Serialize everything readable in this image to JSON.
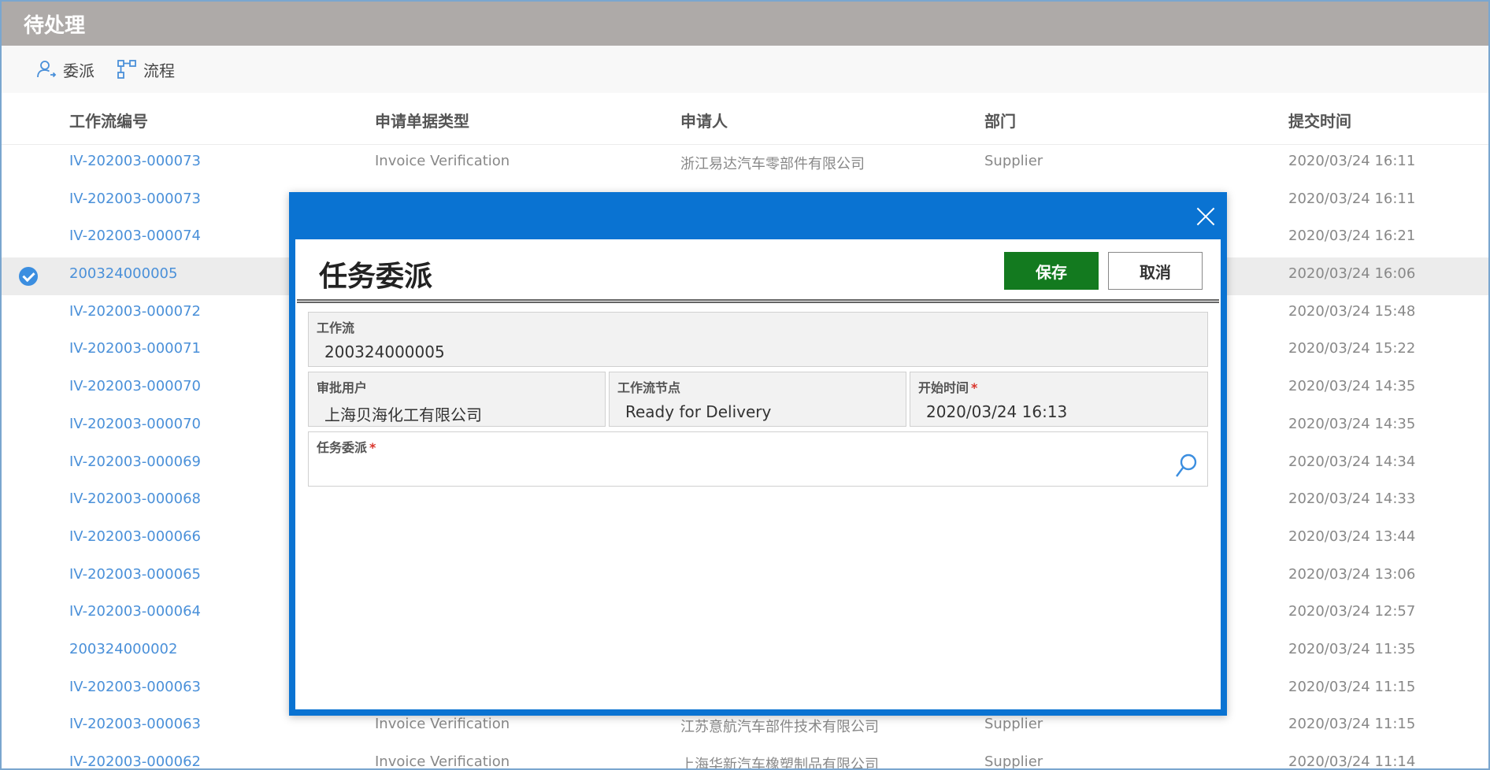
{
  "app": {
    "title": "待处理"
  },
  "toolbar": {
    "delegate_label": "委派",
    "flow_label": "流程"
  },
  "table": {
    "headers": [
      "工作流编号",
      "申请单据类型",
      "申请人",
      "部门",
      "提交时间"
    ],
    "rows": [
      {
        "id": "IV-202003-000073",
        "type": "Invoice Verification",
        "applicant": "浙江易达汽车零部件有限公司",
        "dept": "Supplier",
        "time": "2020/03/24 16:11"
      },
      {
        "id": "IV-202003-000073",
        "type": "",
        "applicant": "",
        "dept": "",
        "time": "2020/03/24 16:11"
      },
      {
        "id": "IV-202003-000074",
        "type": "",
        "applicant": "",
        "dept": "",
        "time": "2020/03/24 16:21"
      },
      {
        "id": "200324000005",
        "type": "",
        "applicant": "",
        "dept": "",
        "time": "2020/03/24 16:06"
      },
      {
        "id": "IV-202003-000072",
        "type": "",
        "applicant": "",
        "dept": "",
        "time": "2020/03/24 15:48"
      },
      {
        "id": "IV-202003-000071",
        "type": "",
        "applicant": "",
        "dept": "",
        "time": "2020/03/24 15:22"
      },
      {
        "id": "IV-202003-000070",
        "type": "",
        "applicant": "",
        "dept": "",
        "time": "2020/03/24 14:35"
      },
      {
        "id": "IV-202003-000070",
        "type": "",
        "applicant": "",
        "dept": "",
        "time": "2020/03/24 14:35"
      },
      {
        "id": "IV-202003-000069",
        "type": "",
        "applicant": "",
        "dept": "",
        "time": "2020/03/24 14:34"
      },
      {
        "id": "IV-202003-000068",
        "type": "",
        "applicant": "",
        "dept": "",
        "time": "2020/03/24 14:33"
      },
      {
        "id": "IV-202003-000066",
        "type": "",
        "applicant": "",
        "dept": "",
        "time": "2020/03/24 13:44"
      },
      {
        "id": "IV-202003-000065",
        "type": "",
        "applicant": "",
        "dept": "",
        "time": "2020/03/24 13:06"
      },
      {
        "id": "IV-202003-000064",
        "type": "",
        "applicant": "",
        "dept": "",
        "time": "2020/03/24 12:57"
      },
      {
        "id": "200324000002",
        "type": "",
        "applicant": "",
        "dept": "",
        "time": "2020/03/24 11:35"
      },
      {
        "id": "IV-202003-000063",
        "type": "",
        "applicant": "",
        "dept": "",
        "time": "2020/03/24 11:15"
      },
      {
        "id": "IV-202003-000063",
        "type": "Invoice Verification",
        "applicant": "江苏意航汽车部件技术有限公司",
        "dept": "Supplier",
        "time": "2020/03/24 11:15"
      },
      {
        "id": "IV-202003-000062",
        "type": "Invoice Verification",
        "applicant": "上海华新汽车橡塑制品有限公司",
        "dept": "Supplier",
        "time": "2020/03/24 11:14"
      }
    ],
    "selected_index": 3
  },
  "dialog": {
    "title": "任务委派",
    "save_label": "保存",
    "cancel_label": "取消",
    "workflow": {
      "label": "工作流",
      "value": "200324000005"
    },
    "approver": {
      "label": "审批用户",
      "value": "上海贝海化工有限公司"
    },
    "node": {
      "label": "工作流节点",
      "value": "Ready for Delivery"
    },
    "start_time": {
      "label": "开始时间",
      "value": "2020/03/24 16:13",
      "required_mark": "*"
    },
    "delegate": {
      "label": "任务委派",
      "value": "",
      "required_mark": "*"
    }
  },
  "colors": {
    "header_bg": "#aeaaa8",
    "dialog_blue": "#0a73d2",
    "save_green": "#137a1f",
    "link_blue": "#4a90d9"
  }
}
